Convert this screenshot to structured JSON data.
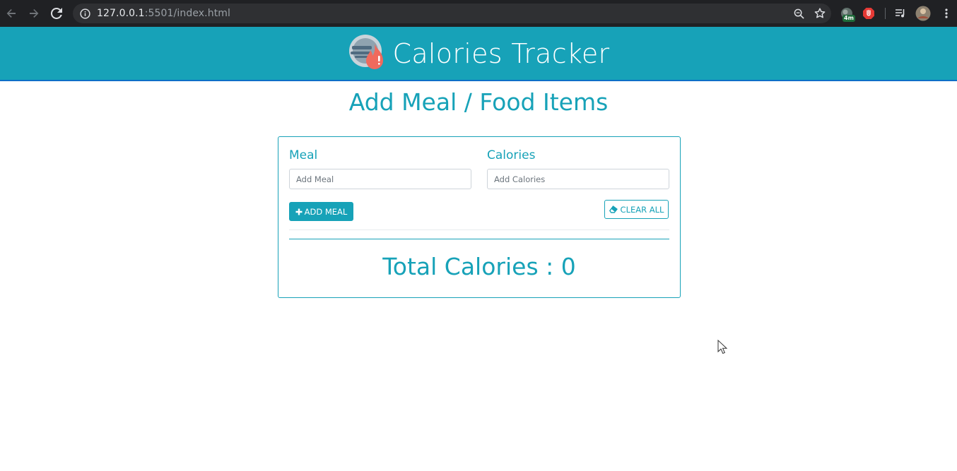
{
  "browser": {
    "url_host": "127.0.0.1",
    "url_rest": ":5501/index.html",
    "extension_badge": "4m",
    "icons": [
      "back-icon",
      "forward-icon",
      "reload-icon",
      "info-icon",
      "zoom-icon",
      "star-icon",
      "extension-icon",
      "adblock-icon",
      "media-control-icon",
      "profile-avatar",
      "menu-icon"
    ]
  },
  "header": {
    "title": "Calories Tracker",
    "logo_icon": "calorie-flame-logo",
    "color": "#17a2b8"
  },
  "main": {
    "heading": "Add Meal / Food Items",
    "form": {
      "meal_label": "Meal",
      "meal_placeholder": "Add Meal",
      "meal_value": "",
      "calories_label": "Calories",
      "calories_placeholder": "Add Calories",
      "calories_value": "",
      "add_button_label": "ADD MEAL",
      "add_button_icon": "plus-icon",
      "clear_button_label": "CLEAR ALL",
      "clear_button_icon": "eraser-icon"
    },
    "total_calories_text": "Total Calories : 0"
  },
  "colors": {
    "accent": "#17a2b8",
    "chrome_bg": "#202124",
    "header_border": "#0e6fc7"
  }
}
